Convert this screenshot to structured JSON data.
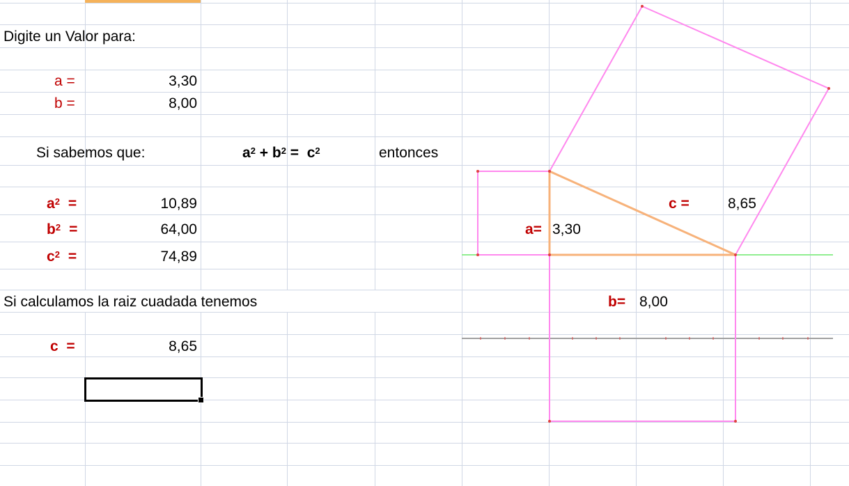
{
  "sheet": {
    "prompt": "Digite un Valor para:",
    "a_label": "a =",
    "a_value": "3,30",
    "b_label": "b =",
    "b_value": "8,00",
    "si_sabemos": "Si sabemos que:",
    "formula": {
      "a": "a",
      "b": "b",
      "c": "c",
      "exp": "2",
      "plus": " + ",
      "equals": " =  "
    },
    "entonces": "entonces",
    "a2_label": "a",
    "b2_label": "b",
    "c2_label": "c",
    "sq_exp": "2",
    "eq_sign": "=",
    "a2_value": "10,89",
    "b2_value": "64,00",
    "c2_value": "74,89",
    "si_calculamos": "Si calculamos la raiz cuadada tenemos",
    "c_label": "c  =",
    "c_value": "8,65"
  },
  "diagram": {
    "c_label": "c =",
    "c_value": "8,65",
    "a_label": "a=",
    "a_value": "3,30",
    "b_label": "b=",
    "b_value": "8,00"
  },
  "colors": {
    "gridline": "#d0d7e5",
    "label_red": "#c00000",
    "square_pink": "#ff88ee",
    "triangle_orange": "#f7b27a",
    "baseline_green": "#90ee90",
    "axis_gray": "#a0a0a0",
    "tick_red": "#e04040",
    "selection": "#000000",
    "active_column": "#f5b25a"
  }
}
